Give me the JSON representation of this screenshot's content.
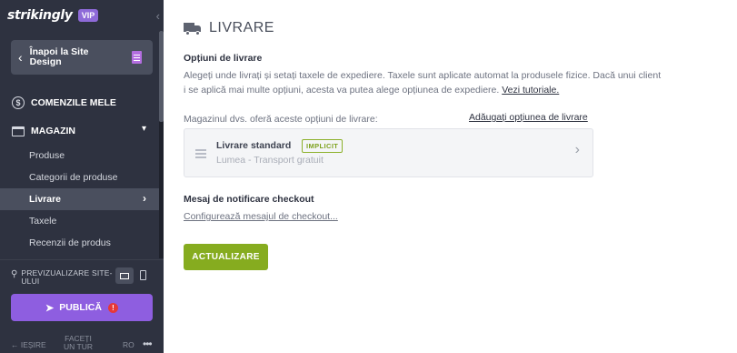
{
  "sidebar": {
    "logo": "strikingly",
    "vip_badge": "VIP",
    "collapse_icon": "chevron-left-icon",
    "back_button": "Înapoi la Site Design",
    "orders": {
      "label": "COMENZILE MELE",
      "icon": "dollar-icon"
    },
    "shop": {
      "label": "MAGAZIN",
      "icon": "store-icon",
      "items": [
        {
          "label": "Produse"
        },
        {
          "label": "Categorii de produse"
        },
        {
          "label": "Livrare",
          "active": true
        },
        {
          "label": "Taxele"
        },
        {
          "label": "Recenzii de produs"
        }
      ]
    },
    "preview_label": "PREVIZUALIZARE SITE-ULUI",
    "publish_label": "PUBLICĂ",
    "publish_alert": "!",
    "footer": {
      "exit": "← IEȘIRE",
      "tour": "FACEȚI UN TUR",
      "lang": "RO",
      "more": "•••"
    }
  },
  "main": {
    "header_icon": "truck-icon",
    "title": "LIVRARE",
    "options_title": "Opțiuni de livrare",
    "description": "Alegeți unde livrați și setați taxele de expediere. Taxele sunt aplicate automat la produsele fizice. Dacă unui client i se aplică mai multe opțiuni, acesta va putea alege opțiunea de expediere.",
    "tutorial_link": "Vezi tutoriale.",
    "offer_label": "Magazinul dvs. oferă aceste opțiuni de livrare:",
    "add_option_link": "Adăugați opțiunea de livrare",
    "shipping_option": {
      "name": "Livrare standard",
      "badge": "IMPLICIT",
      "subtitle": "Lumea - Transport gratuit"
    },
    "checkout_title": "Mesaj de notificare checkout",
    "checkout_link": "Configurează mesajul de checkout...",
    "update_button": "ACTUALIZARE"
  },
  "colors": {
    "sidebar_bg": "#2e3240",
    "publish": "#8e5ee0",
    "update": "#86ac1f",
    "badge": "#8cb12a"
  }
}
